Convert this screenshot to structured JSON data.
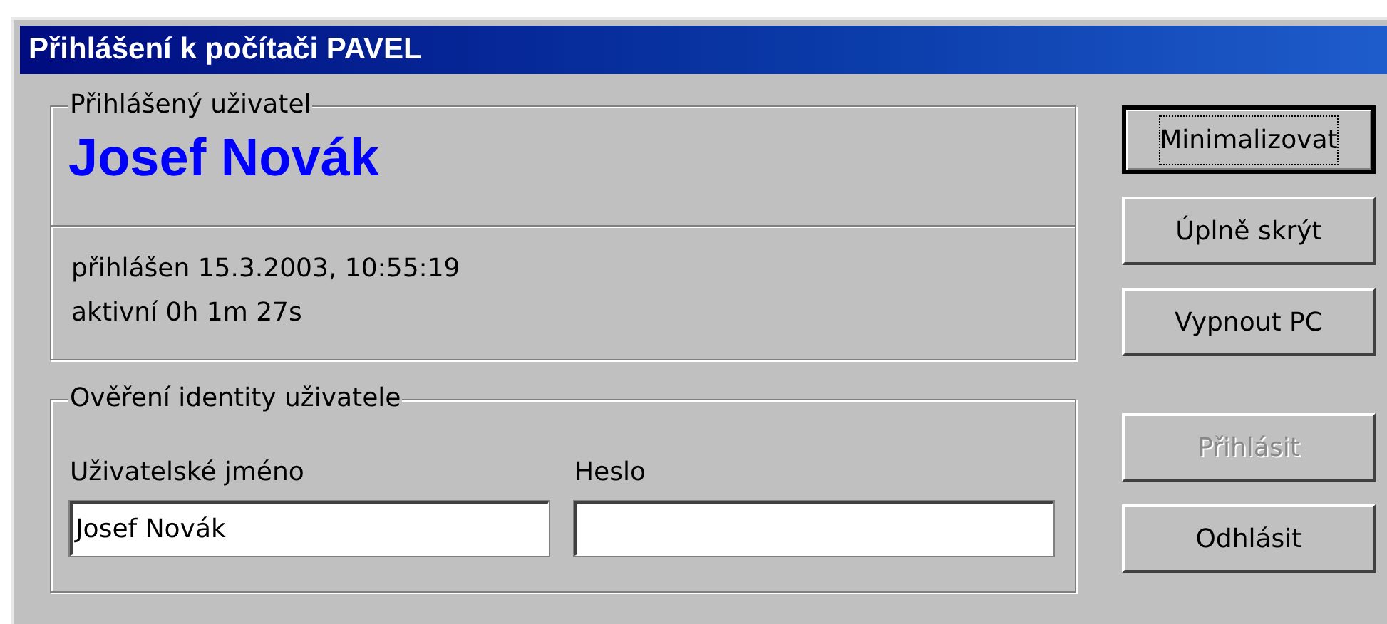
{
  "window": {
    "title": "Přihlášení k počítači PAVEL"
  },
  "logged_user": {
    "legend": "Přihlášený uživatel",
    "name": "Josef Novák",
    "lines": [
      "přihlášen 15.3.2003, 10:55:19",
      "aktivní 0h 1m 27s"
    ]
  },
  "verification": {
    "legend": "Ověření identity uživatele",
    "fields": [
      {
        "label": "Uživatelské jméno",
        "value": "Josef Novák"
      },
      {
        "label": "Heslo"
      }
    ]
  },
  "button_groups": [
    {
      "buttons": [
        {
          "label": "Minimalizovat",
          "default": true,
          "disabled": false
        },
        {
          "label": "Úplně skrýt",
          "default": false,
          "disabled": false
        },
        {
          "label": "Vypnout PC",
          "default": false,
          "disabled": false
        }
      ]
    },
    {
      "buttons": [
        {
          "label": "Přihlásit",
          "default": false,
          "disabled": true
        },
        {
          "label": "Odhlásit",
          "default": false,
          "disabled": false
        }
      ]
    }
  ]
}
